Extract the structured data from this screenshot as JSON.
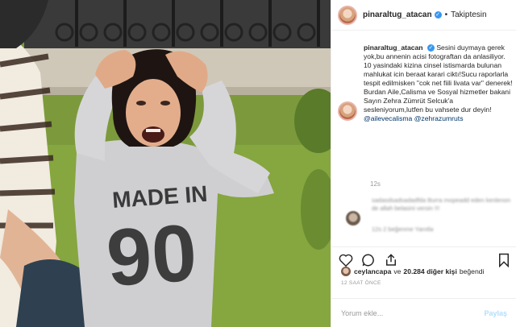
{
  "post": {
    "username": "pinaraltug_atacan",
    "follow_label": "Takiptesin",
    "separator": "•"
  },
  "caption": {
    "username": "pinaraltug_atacan",
    "text": "Sesini duymaya gerek yok,bu annenin acisi fotograftan da anlasiliyor. 10 yasindaki kizina cinsel istismarda bulunan mahlukat icin beraat karari ciktı!Sucu raporlarla tespit edilmisken \"cok net fiili livata var\" denerek! Burdan Aile,Calisma ve Sosyal hizmetler bakani Sayın Zehra Zümrüt Selcuk'a sesleniyorum,lutfen bu vahsete dur deyin!",
    "mention1": "@ailevecalisma",
    "mention2": "@zehrazumruts",
    "time": "12s"
  },
  "comment": {
    "text": "sadasdsadsadadfda Burra mopeadd eden kenlenon de allah belasini versin !!!",
    "meta": "12s   2 beğenme   Yanıtla"
  },
  "likes": {
    "user": "ceylancapa",
    "connector": "ve",
    "count": "20.284 diğer kişi",
    "suffix": "beğendi"
  },
  "timestamp": "12 SAAT ÖNCE",
  "add_comment": {
    "placeholder": "Yorum ekle...",
    "send_label": "Paylaş"
  },
  "shirt_text": {
    "line1": "MADE IN",
    "line2": "90"
  },
  "colors": {
    "link": "#003569",
    "verified": "#3897f0",
    "muted": "#999999",
    "send_disabled": "#b2dffc"
  },
  "icons": [
    "heart-icon",
    "comment-icon",
    "share-icon",
    "bookmark-icon",
    "verified-badge-icon"
  ]
}
